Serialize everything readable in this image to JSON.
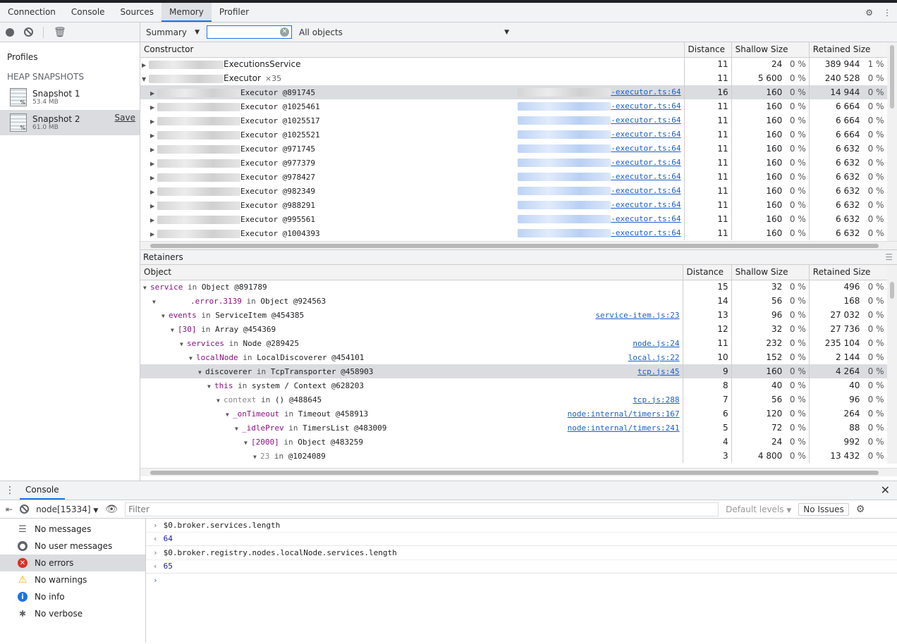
{
  "tabs": [
    "Connection",
    "Console",
    "Sources",
    "Memory",
    "Profiler"
  ],
  "active_tab": "Memory",
  "sidebar": {
    "profiles_title": "Profiles",
    "heap_title": "HEAP SNAPSHOTS",
    "snapshots": [
      {
        "name": "Snapshot 1",
        "size": "53.4 MB"
      },
      {
        "name": "Snapshot 2",
        "size": "61.0 MB",
        "save": "Save"
      }
    ]
  },
  "filterbar": {
    "view": "Summary",
    "objects": "All objects"
  },
  "constructor_table": {
    "headers": [
      "Constructor",
      "Distance",
      "Shallow Size",
      "Retained Size"
    ],
    "rows": [
      {
        "name": "ExecutionsService",
        "dist": "11",
        "sh": "24",
        "shp": "0 %",
        "rt": "389 944",
        "rtp": "1 %"
      },
      {
        "name": "Executor",
        "count": "×35",
        "dist": "11",
        "sh": "5 600",
        "shp": "0 %",
        "rt": "240 528",
        "rtp": "0 %"
      },
      {
        "name": "Executor @891745",
        "link": "-executor.ts:64",
        "dist": "16",
        "sh": "160",
        "shp": "0 %",
        "rt": "14 944",
        "rtp": "0 %"
      },
      {
        "name": "Executor @1025461",
        "link": "-executor.ts:64",
        "dist": "11",
        "sh": "160",
        "shp": "0 %",
        "rt": "6 664",
        "rtp": "0 %"
      },
      {
        "name": "Executor @1025517",
        "link": "-executor.ts:64",
        "dist": "11",
        "sh": "160",
        "shp": "0 %",
        "rt": "6 664",
        "rtp": "0 %"
      },
      {
        "name": "Executor @1025521",
        "link": "-executor.ts:64",
        "dist": "11",
        "sh": "160",
        "shp": "0 %",
        "rt": "6 664",
        "rtp": "0 %"
      },
      {
        "name": "Executor @971745",
        "link": "-executor.ts:64",
        "dist": "11",
        "sh": "160",
        "shp": "0 %",
        "rt": "6 632",
        "rtp": "0 %"
      },
      {
        "name": "Executor @977379",
        "link": "-executor.ts:64",
        "dist": "11",
        "sh": "160",
        "shp": "0 %",
        "rt": "6 632",
        "rtp": "0 %"
      },
      {
        "name": "Executor @978427",
        "link": "-executor.ts:64",
        "dist": "11",
        "sh": "160",
        "shp": "0 %",
        "rt": "6 632",
        "rtp": "0 %"
      },
      {
        "name": "Executor @982349",
        "link": "-executor.ts:64",
        "dist": "11",
        "sh": "160",
        "shp": "0 %",
        "rt": "6 632",
        "rtp": "0 %"
      },
      {
        "name": "Executor @988291",
        "link": "-executor.ts:64",
        "dist": "11",
        "sh": "160",
        "shp": "0 %",
        "rt": "6 632",
        "rtp": "0 %"
      },
      {
        "name": "Executor @995561",
        "link": "-executor.ts:64",
        "dist": "11",
        "sh": "160",
        "shp": "0 %",
        "rt": "6 632",
        "rtp": "0 %"
      },
      {
        "name": "Executor @1004393",
        "link": "-executor.ts:64",
        "dist": "11",
        "sh": "160",
        "shp": "0 %",
        "rt": "6 632",
        "rtp": "0 %"
      }
    ]
  },
  "retainers": {
    "title": "Retainers",
    "headers": [
      "Object",
      "Distance",
      "Shallow Size",
      "Retained Size"
    ],
    "rows": [
      {
        "key": "service",
        "in": "in",
        "obj": "Object @891789",
        "dist": "15",
        "sh": "32",
        "shp": "0 %",
        "rt": "496",
        "rtp": "0 %"
      },
      {
        "key": ".error.3139",
        "in": "in",
        "obj": "Object @924563",
        "dist": "14",
        "sh": "56",
        "shp": "0 %",
        "rt": "168",
        "rtp": "0 %"
      },
      {
        "key": "events",
        "in": "in",
        "obj": "ServiceItem @454385",
        "link": "service-item.js:23",
        "dist": "13",
        "sh": "96",
        "shp": "0 %",
        "rt": "27 032",
        "rtp": "0 %"
      },
      {
        "key": "[30]",
        "in": "in",
        "obj": "Array @454369",
        "dist": "12",
        "sh": "32",
        "shp": "0 %",
        "rt": "27 736",
        "rtp": "0 %"
      },
      {
        "key": "services",
        "in": "in",
        "obj": "Node @289425",
        "link": "node.js:24",
        "dist": "11",
        "sh": "232",
        "shp": "0 %",
        "rt": "235 104",
        "rtp": "0 %"
      },
      {
        "key": "localNode",
        "in": "in",
        "obj": "LocalDiscoverer @454101",
        "link": "local.js:22",
        "dist": "10",
        "sh": "152",
        "shp": "0 %",
        "rt": "2 144",
        "rtp": "0 %"
      },
      {
        "key": "discoverer",
        "in": "in",
        "obj": "TcpTransporter @458903",
        "link": "tcp.js:45",
        "dist": "9",
        "sh": "160",
        "shp": "0 %",
        "rt": "4 264",
        "rtp": "0 %"
      },
      {
        "key": "this",
        "in": "in",
        "obj": "system / Context @628203",
        "dist": "8",
        "sh": "40",
        "shp": "0 %",
        "rt": "40",
        "rtp": "0 %"
      },
      {
        "key": "context",
        "in": "in",
        "obj": "() @488645",
        "link": "tcp.js:288",
        "dist": "7",
        "sh": "56",
        "shp": "0 %",
        "rt": "96",
        "rtp": "0 %"
      },
      {
        "key": "_onTimeout",
        "in": "in",
        "obj": "Timeout @458913",
        "link": "node:internal/timers:167",
        "dist": "6",
        "sh": "120",
        "shp": "0 %",
        "rt": "264",
        "rtp": "0 %"
      },
      {
        "key": "_idlePrev",
        "in": "in",
        "obj": "TimersList @483009",
        "link": "node:internal/timers:241",
        "dist": "5",
        "sh": "72",
        "shp": "0 %",
        "rt": "88",
        "rtp": "0 %"
      },
      {
        "key": "[2000]",
        "in": "in",
        "obj": "Object @483259",
        "dist": "4",
        "sh": "24",
        "shp": "0 %",
        "rt": "992",
        "rtp": "0 %"
      },
      {
        "key": "23",
        "in": "in",
        "obj": "@1024089",
        "dist": "3",
        "sh": "4 800",
        "shp": "0 %",
        "rt": "13 432",
        "rtp": "0 %"
      }
    ]
  },
  "drawer": {
    "tab": "Console",
    "context": "node[15334]",
    "filter_placeholder": "Filter",
    "levels": "Default levels",
    "issues": "No Issues",
    "side": [
      "No messages",
      "No user messages",
      "No errors",
      "No warnings",
      "No info",
      "No verbose"
    ],
    "lines": [
      {
        "cmd": "$0.broker.services.length",
        "res": "64"
      },
      {
        "cmd": "$0.broker.registry.nodes.localNode.services.length",
        "res": "65"
      }
    ]
  }
}
